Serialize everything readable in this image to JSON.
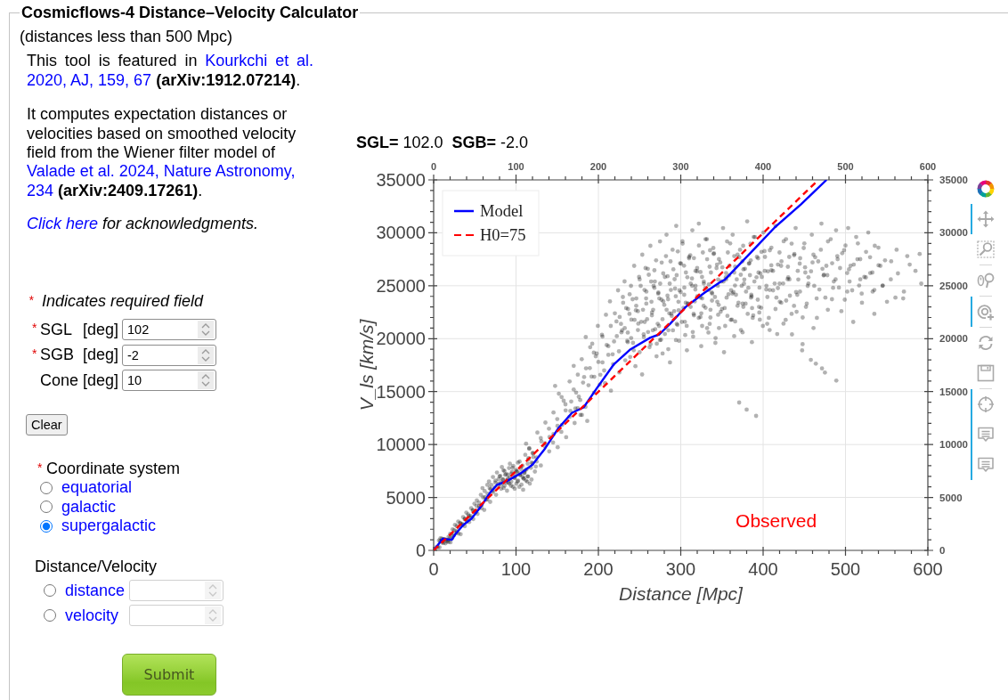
{
  "title": "Cosmicflows-4 Distance–Velocity Calculator",
  "subtitle": "(distances less than 500 Mpc)",
  "intro": [
    {
      "kind": "justified",
      "parts": [
        {
          "text": "This tool is featured in ",
          "kind": "text"
        },
        {
          "text": "Kourkchi et al.",
          "kind": "link"
        },
        {
          "text": "2020, AJ, 159, 67",
          "kind": "link"
        },
        {
          "text": " **(arXiv:1912.07214)**.",
          "kind": "text"
        }
      ]
    },
    {
      "kind": "plain",
      "parts": [
        {
          "text": "It computes expectation distances or velocities based on smoothed velocity field from the Wiener filter model of ",
          "kind": "text"
        },
        {
          "text": "Valade et al. 2024, Nature Astronomy,",
          "kind": "link"
        },
        {
          "text": "234",
          "kind": "link"
        },
        {
          "text": " **(arXiv:2409.17261)**.",
          "kind": "text"
        }
      ]
    },
    {
      "kind": "italic",
      "parts": [
        {
          "text": "Click here",
          "kind": "link"
        },
        {
          "text": " for acknowledgments.",
          "kind": "text"
        }
      ]
    }
  ],
  "required_note": {
    "marker": "*",
    "text": "Indicates required field"
  },
  "fields": [
    {
      "marker": "*",
      "label": "SGL",
      "unit": "[deg]",
      "value": "102"
    },
    {
      "marker": "*",
      "label": "SGB",
      "unit": "[deg]",
      "value": "-2"
    },
    {
      "label": "Cone",
      "unit": "[deg]",
      "value": "10"
    }
  ],
  "clear_button": "Clear",
  "coordinate_system": {
    "marker": "*",
    "label": "Coordinate system",
    "options": [
      {
        "label": "equatorial",
        "selected": false
      },
      {
        "label": "galactic",
        "selected": false
      },
      {
        "label": "supergalactic",
        "selected": true
      }
    ]
  },
  "distance_velocity": {
    "label": "Distance/Velocity",
    "options": [
      {
        "label": "distance",
        "selected": false,
        "disabled": true
      },
      {
        "label": "velocity",
        "selected": false,
        "disabled": true
      }
    ]
  },
  "submit_button": "Submit",
  "chart": {
    "title": [
      "**SGL=** 102.0",
      "**SGB=** -2.0"
    ],
    "top_axis_labels": [
      "0",
      "100",
      "200",
      "300",
      "400",
      "500",
      "600"
    ],
    "right_axis_labels": [
      "35000",
      "30000",
      "25000",
      "20000",
      "15000",
      "10000",
      "5000",
      "0"
    ],
    "chart_data": {
      "type": "line",
      "xlabel": "Distance [Mpc]",
      "ylabel": "V_ls [km/s]",
      "xlim": [
        0,
        600
      ],
      "ylim": [
        0,
        35000
      ],
      "xticks": [
        0,
        100,
        200,
        300,
        400,
        500,
        600
      ],
      "yticks": [
        0,
        5000,
        10000,
        15000,
        20000,
        25000,
        30000,
        35000
      ],
      "grid": true,
      "legend": "upper left",
      "series": [
        {
          "name": "Model",
          "line_style": "solid",
          "color": "#0000ff",
          "x": [
            0,
            11,
            22,
            27,
            36,
            46,
            57,
            68,
            77,
            90,
            106,
            120,
            135,
            151,
            168,
            182,
            198,
            219,
            239,
            263,
            274,
            287,
            306,
            328,
            347,
            354,
            371,
            392,
            414,
            446,
            477
          ],
          "values": [
            0,
            1100,
            1000,
            1600,
            2400,
            3000,
            4100,
            5400,
            6200,
            6600,
            7300,
            8100,
            9600,
            11500,
            13000,
            13500,
            15300,
            17600,
            19000,
            20100,
            20400,
            21400,
            23000,
            24300,
            25300,
            25600,
            27000,
            28700,
            30500,
            32700,
            35000
          ]
        },
        {
          "name": "H0=75",
          "line_style": "dashed",
          "color": "#ff0000",
          "x": [
            0,
            467
          ],
          "values": [
            0,
            35000
          ]
        }
      ],
      "annotations": [
        "Observed"
      ]
    }
  },
  "toolbar": [
    {
      "kind": "pan",
      "active": true,
      "separated": false
    },
    {
      "kind": "box-zoom",
      "active": false,
      "separated": false
    },
    {
      "kind": "wheel-zoom",
      "active": false,
      "separated": true
    },
    {
      "kind": "zoom-in",
      "active": true,
      "separated": true
    },
    {
      "kind": "reset",
      "active": false,
      "separated": true
    },
    {
      "kind": "save",
      "active": false,
      "separated": false
    },
    {
      "kind": "crosshair",
      "active": true,
      "separated": true
    },
    {
      "kind": "hover",
      "active": true,
      "separated": false
    },
    {
      "kind": "hover",
      "active": true,
      "separated": false
    }
  ]
}
